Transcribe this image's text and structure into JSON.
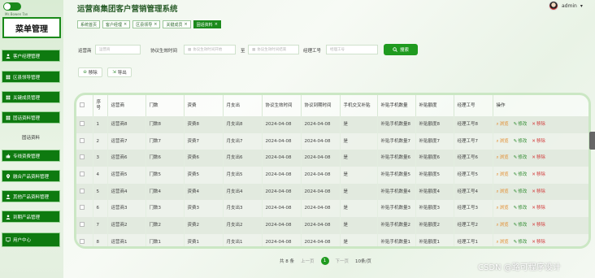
{
  "app": {
    "title": "运营商集团客户营销管理系统"
  },
  "sidebar": {
    "caption": "Ms Bowen Tan",
    "logo_text": "菜单管理",
    "items": [
      {
        "label": "客户经理管理",
        "active": false
      },
      {
        "label": "区县领导管理",
        "active": false
      },
      {
        "label": "关键成员管理",
        "active": false
      },
      {
        "label": "固话资料管理",
        "active": false
      },
      {
        "label": "固话资料",
        "active": true
      },
      {
        "label": "专线资费管理",
        "active": false
      },
      {
        "label": "融合产品资料管理",
        "active": false
      },
      {
        "label": "其他产品资料管理",
        "active": false
      },
      {
        "label": "到期产品管理",
        "active": false
      },
      {
        "label": "用户中心",
        "active": false
      }
    ]
  },
  "user": {
    "name": "admin",
    "caret": "▾"
  },
  "tabs": [
    {
      "label": "系统首页",
      "closable": false,
      "active": false
    },
    {
      "label": "客户经理",
      "closable": true,
      "active": false
    },
    {
      "label": "区县领导",
      "closable": true,
      "active": false
    },
    {
      "label": "关键成员",
      "closable": true,
      "active": false
    },
    {
      "label": "固话资料",
      "closable": true,
      "active": true
    }
  ],
  "search": {
    "operator_label": "运营商",
    "operator_placeholder": "运营商",
    "start_label": "协议生效时间",
    "start_placeholder": "协议生效时间开始",
    "to_label": "至",
    "end_placeholder": "协议生效时间结束",
    "manager_label": "经理工号",
    "manager_placeholder": "经理工号",
    "search_button": "搜索"
  },
  "actions": {
    "delete": "移除",
    "export": "导出"
  },
  "table": {
    "headers": [
      "序号",
      "运营商",
      "门数",
      "资费",
      "月支出",
      "协议生效时间",
      "协议到期时间",
      "手机交叉补贴",
      "补贴手机数量",
      "补贴额度",
      "经理工号",
      "操作"
    ],
    "rows": [
      [
        "1",
        "运营商8",
        "门数8",
        "资费8",
        "月支出8",
        "2024-04-08",
        "2024-04-08",
        "是",
        "补贴手机数量8",
        "补贴额度8",
        "经理工号8"
      ],
      [
        "2",
        "运营商7",
        "门数7",
        "资费7",
        "月支出7",
        "2024-04-08",
        "2024-04-08",
        "是",
        "补贴手机数量7",
        "补贴额度7",
        "经理工号7"
      ],
      [
        "3",
        "运营商6",
        "门数6",
        "资费6",
        "月支出6",
        "2024-04-08",
        "2024-04-08",
        "是",
        "补贴手机数量6",
        "补贴额度6",
        "经理工号6"
      ],
      [
        "4",
        "运营商5",
        "门数5",
        "资费5",
        "月支出5",
        "2024-04-08",
        "2024-04-08",
        "是",
        "补贴手机数量5",
        "补贴额度5",
        "经理工号5"
      ],
      [
        "5",
        "运营商4",
        "门数4",
        "资费4",
        "月支出4",
        "2024-04-08",
        "2024-04-08",
        "是",
        "补贴手机数量4",
        "补贴额度4",
        "经理工号4"
      ],
      [
        "6",
        "运营商3",
        "门数3",
        "资费3",
        "月支出3",
        "2024-04-08",
        "2024-04-08",
        "是",
        "补贴手机数量3",
        "补贴额度3",
        "经理工号3"
      ],
      [
        "7",
        "运营商2",
        "门数2",
        "资费2",
        "月支出2",
        "2024-04-08",
        "2024-04-08",
        "是",
        "补贴手机数量2",
        "补贴额度2",
        "经理工号2"
      ],
      [
        "8",
        "运营商1",
        "门数1",
        "资费1",
        "月支出1",
        "2024-04-08",
        "2024-04-08",
        "是",
        "补贴手机数量1",
        "补贴额度1",
        "经理工号1"
      ]
    ],
    "ops": {
      "view": "浏览",
      "edit": "修改",
      "del": "移除"
    }
  },
  "pager": {
    "total": "共 8 条",
    "prev": "上一页",
    "current": "1",
    "next": "下一页",
    "size": "10条/页"
  },
  "watermark": "CSDN @路可程序设计",
  "colors": {
    "primary": "#1a8a1a",
    "menu": "#0e7a10",
    "view": "#e28a2b",
    "edit": "#2f8a2f",
    "delete": "#d23c3c"
  }
}
